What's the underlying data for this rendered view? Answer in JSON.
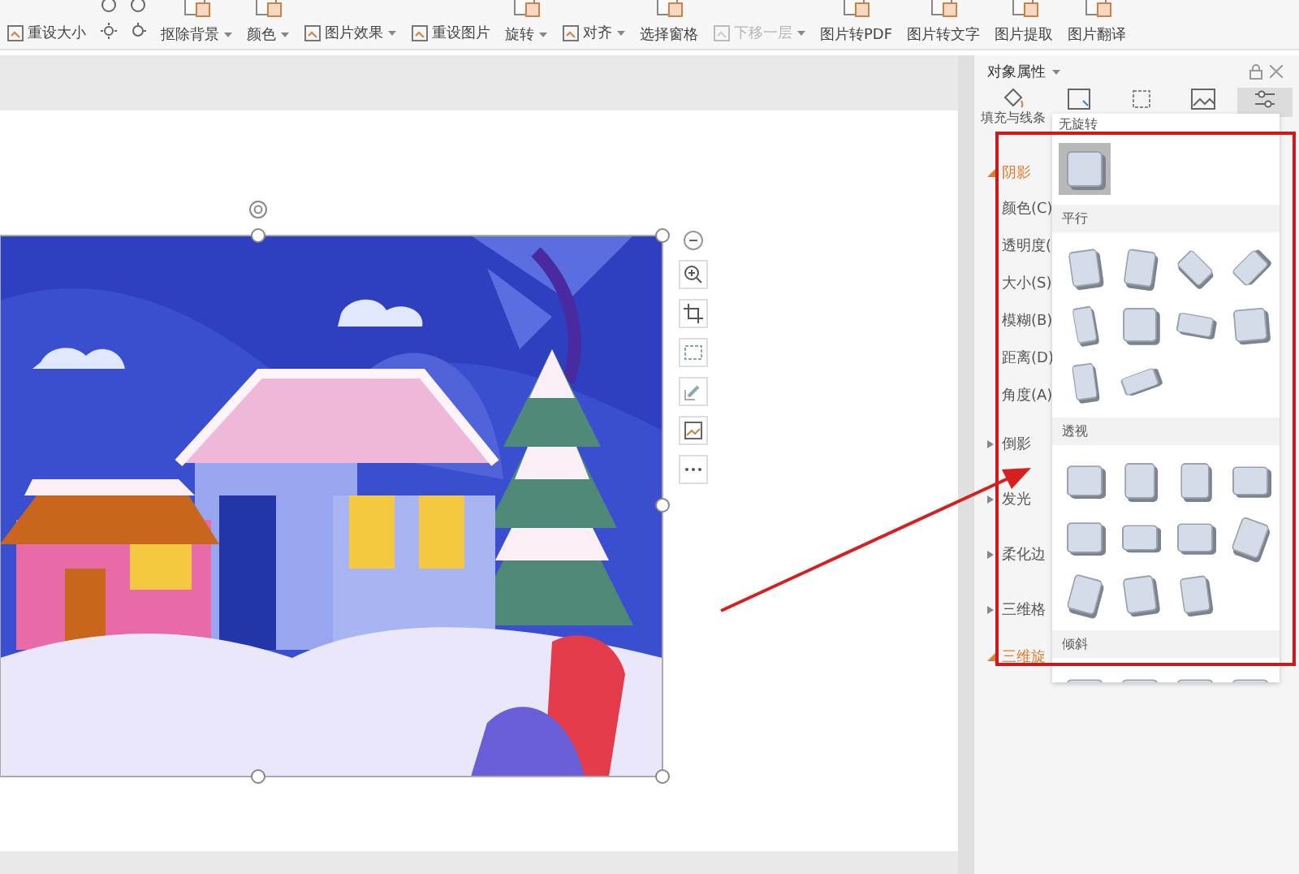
{
  "ribbon": {
    "columns": [
      {
        "kind": "small",
        "items": [
          {
            "label": "重设大小",
            "dropdown": false,
            "disabled": false
          }
        ]
      },
      {
        "kind": "icons"
      },
      {
        "kind": "large",
        "label": "抠除背景",
        "dropdown": true
      },
      {
        "kind": "large",
        "label": "颜色",
        "dropdown": true
      },
      {
        "kind": "small",
        "items": [
          {
            "label": "图片效果",
            "dropdown": true,
            "disabled": false
          }
        ]
      },
      {
        "kind": "small",
        "items": [
          {
            "label": "重设图片",
            "dropdown": false,
            "disabled": false
          }
        ]
      },
      {
        "kind": "large",
        "label": "旋转",
        "dropdown": true
      },
      {
        "kind": "small",
        "items": [
          {
            "label": "对齐",
            "dropdown": true,
            "disabled": false
          }
        ]
      },
      {
        "kind": "large",
        "label": "选择窗格",
        "dropdown": false
      },
      {
        "kind": "small",
        "items": [
          {
            "label": "下移一层",
            "dropdown": true,
            "disabled": true
          }
        ]
      },
      {
        "kind": "large",
        "label": "图片转PDF",
        "dropdown": false
      },
      {
        "kind": "large",
        "label": "图片转文字",
        "dropdown": false
      },
      {
        "kind": "large",
        "label": "图片提取",
        "dropdown": false
      },
      {
        "kind": "large",
        "label": "图片翻译",
        "dropdown": false
      }
    ]
  },
  "panel": {
    "title": "对象属性",
    "tabs": [
      {
        "label": "填充与线条",
        "selected": false
      },
      {
        "selected": false
      },
      {
        "selected": false
      },
      {
        "selected": false
      },
      {
        "selected": true
      }
    ],
    "sections": [
      {
        "label": "阴影",
        "expanded": true,
        "children": [
          {
            "label": "颜色(C)"
          },
          {
            "label": "透明度("
          },
          {
            "label": "大小(S)"
          },
          {
            "label": "模糊(B)"
          },
          {
            "label": "距离(D)"
          },
          {
            "label": "角度(A)"
          }
        ]
      },
      {
        "label": "倒影",
        "expanded": false
      },
      {
        "label": "发光",
        "expanded": false
      },
      {
        "label": "柔化边",
        "expanded": false
      },
      {
        "label": "三维格",
        "expanded": false
      },
      {
        "label": "三维旋",
        "expanded": true
      }
    ]
  },
  "rotation_popup": {
    "title": "无旋转",
    "groups": [
      {
        "presets": [
          {
            "selected": true
          }
        ]
      },
      {
        "title": "平行",
        "presets": [
          {
            "selected": false
          },
          {
            "selected": false
          },
          {
            "selected": false
          },
          {
            "selected": false
          },
          {
            "selected": false
          },
          {
            "selected": false
          },
          {
            "selected": false
          },
          {
            "selected": false
          },
          {
            "selected": false
          },
          {
            "selected": false
          }
        ]
      },
      {
        "title": "透视",
        "presets": [
          {
            "selected": false
          },
          {
            "selected": false
          },
          {
            "selected": false
          },
          {
            "selected": false
          },
          {
            "selected": false
          },
          {
            "selected": false
          },
          {
            "selected": false
          },
          {
            "selected": false
          },
          {
            "selected": false
          },
          {
            "selected": false
          },
          {
            "selected": false
          }
        ]
      },
      {
        "title": "倾斜",
        "presets": [
          {
            "selected": false
          },
          {
            "selected": false
          },
          {
            "selected": false
          },
          {
            "selected": false
          }
        ]
      }
    ]
  }
}
